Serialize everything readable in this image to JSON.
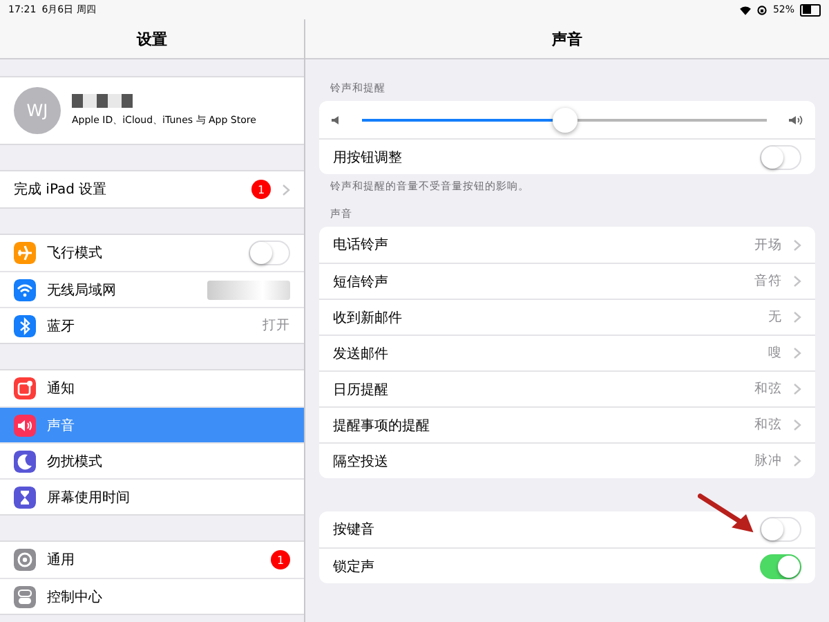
{
  "status_bar": {
    "time": "17:21",
    "date": "6月6日 周四",
    "battery": "52%"
  },
  "sidebar": {
    "title": "设置",
    "profile": {
      "initials": "WJ",
      "subtitle": "Apple ID、iCloud、iTunes 与 App Store"
    },
    "setup": {
      "label": "完成 iPad 设置",
      "badge": "1"
    },
    "groups": [
      [
        {
          "kind": "toggle",
          "color": "#ff9500",
          "label": "飞行模式",
          "on": false,
          "selected": false
        },
        {
          "kind": "blurred",
          "color": "#147efb",
          "label": "无线局域网",
          "selected": false
        },
        {
          "kind": "value",
          "color": "#147efb",
          "label": "蓝牙",
          "value": "打开",
          "selected": false
        }
      ],
      [
        {
          "kind": "plain",
          "color": "#fc3d39",
          "label": "通知",
          "selected": false
        },
        {
          "kind": "plain",
          "color": "#fc3158",
          "label": "声音",
          "selected": true
        },
        {
          "kind": "plain",
          "color": "#5856d6",
          "label": "勿扰模式",
          "selected": false
        },
        {
          "kind": "plain",
          "color": "#5856d6",
          "label": "屏幕使用时间",
          "selected": false
        }
      ],
      [
        {
          "kind": "badge",
          "color": "#8e8e93",
          "label": "通用",
          "badge": "1",
          "selected": false
        },
        {
          "kind": "plain",
          "color": "#8e8e93",
          "label": "控制中心",
          "selected": false
        }
      ]
    ]
  },
  "detail": {
    "title": "声音",
    "ringer": {
      "header": "铃声和提醒",
      "level": 0.5,
      "toggle_label": "用按钮调整",
      "on": false,
      "footnote": "铃声和提醒的音量不受音量按钮的影响。"
    },
    "sounds": {
      "header": "声音",
      "rows": [
        {
          "label": "电话铃声",
          "value": "开场"
        },
        {
          "label": "短信铃声",
          "value": "音符"
        },
        {
          "label": "收到新邮件",
          "value": "无"
        },
        {
          "label": "发送邮件",
          "value": "嗖"
        },
        {
          "label": "日历提醒",
          "value": "和弦"
        },
        {
          "label": "提醒事项的提醒",
          "value": "和弦"
        },
        {
          "label": "隔空投送",
          "value": "脉冲"
        }
      ]
    },
    "feedback": [
      {
        "label": "按键音",
        "on": false
      },
      {
        "label": "锁定声",
        "on": true
      }
    ]
  }
}
